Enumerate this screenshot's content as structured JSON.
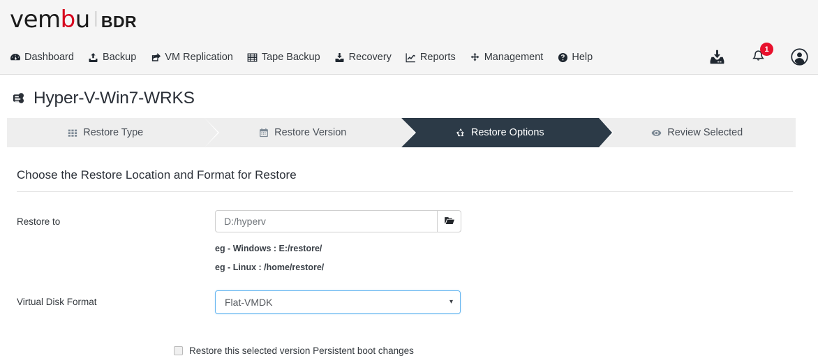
{
  "brand": {
    "name_part1": "vem",
    "name_part2": "b",
    "name_part3": "u",
    "product": "BDR",
    "accent_color": "#d6001c"
  },
  "nav": {
    "items": [
      {
        "label": "Dashboard",
        "icon": "dashboard-icon"
      },
      {
        "label": "Backup",
        "icon": "upload-icon"
      },
      {
        "label": "VM Replication",
        "icon": "share-icon"
      },
      {
        "label": "Tape Backup",
        "icon": "tape-icon"
      },
      {
        "label": "Recovery",
        "icon": "download-icon"
      },
      {
        "label": "Reports",
        "icon": "chart-line-icon"
      },
      {
        "label": "Management",
        "icon": "arrows-icon"
      },
      {
        "label": "Help",
        "icon": "question-circle-icon"
      }
    ]
  },
  "header_right": {
    "downloads_icon": "inbox-download-icon",
    "notifications_icon": "bell-icon",
    "notifications_count": "1",
    "notifications_badge_color": "#e8112d",
    "account_icon": "user-circle-icon"
  },
  "page": {
    "title": "Hyper-V-Win7-WRKS",
    "title_icon": "hand-pointer-icon"
  },
  "steps": {
    "items": [
      {
        "label": "Restore Type",
        "icon": "grid-icon",
        "active": false
      },
      {
        "label": "Restore Version",
        "icon": "calendar-icon",
        "active": false
      },
      {
        "label": "Restore Options",
        "icon": "recycle-icon",
        "active": true
      },
      {
        "label": "Review Selected",
        "icon": "eye-icon",
        "active": false
      }
    ],
    "active_color": "#2c3a47",
    "inactive_color": "#eeeeee"
  },
  "form": {
    "section_title": "Choose the Restore Location and Format for Restore",
    "restore_to": {
      "label": "Restore to",
      "value": "D:/hyperv",
      "placeholder": "D:/hyperv",
      "browse_icon": "folder-open-icon"
    },
    "hints": [
      "eg - Windows : E:/restore/",
      "eg - Linux : /home/restore/"
    ],
    "virtual_disk_format": {
      "label": "Virtual Disk Format",
      "selected": "Flat-VMDK",
      "caret": "▾",
      "focus_color": "#64b5f0"
    },
    "persistent_boot": {
      "label": "Restore this selected version Persistent boot changes",
      "checked": false
    }
  }
}
